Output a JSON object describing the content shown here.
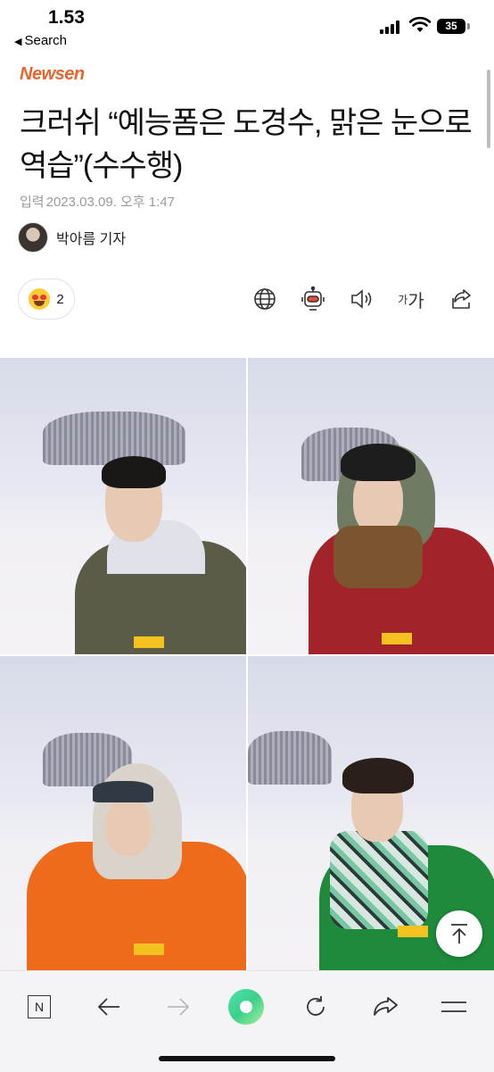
{
  "status_bar": {
    "time": "1.53",
    "back_label": "Search",
    "battery": "35"
  },
  "brand": {
    "name": "Newsen"
  },
  "article": {
    "title": "크러쉬 “예능폼은 도경수, 맑은 눈으로 역습”(수수행)",
    "date_label": "입력",
    "date": "2023.03.09. 오후 1:47",
    "reporter": "박아름 기자"
  },
  "reactions": {
    "emoji": "heart-eyes-emoji",
    "count": "2"
  },
  "toolbar": {
    "icons": [
      "globe-icon",
      "robot-icon",
      "speaker-icon",
      "font-size-icon",
      "share-icon"
    ],
    "font_size_label_small": "가",
    "font_size_label_large": "가"
  },
  "photos": [
    {
      "name": "photo-top-left",
      "jacket_color": "#5c5b47"
    },
    {
      "name": "photo-top-right",
      "jacket_color": "#a2232a"
    },
    {
      "name": "photo-bottom-left",
      "jacket_color": "#ef6b1c"
    },
    {
      "name": "photo-bottom-right",
      "jacket_color": "#1f8a3c"
    }
  ],
  "bottom_bar": {
    "icons": [
      "naver-n-icon",
      "back-arrow-icon",
      "forward-arrow-icon",
      "green-dot-icon",
      "refresh-icon",
      "share-arrow-icon",
      "menu-icon"
    ],
    "n_label": "N"
  },
  "colors": {
    "brand": "#e8642c",
    "green": "#3ad08a"
  }
}
